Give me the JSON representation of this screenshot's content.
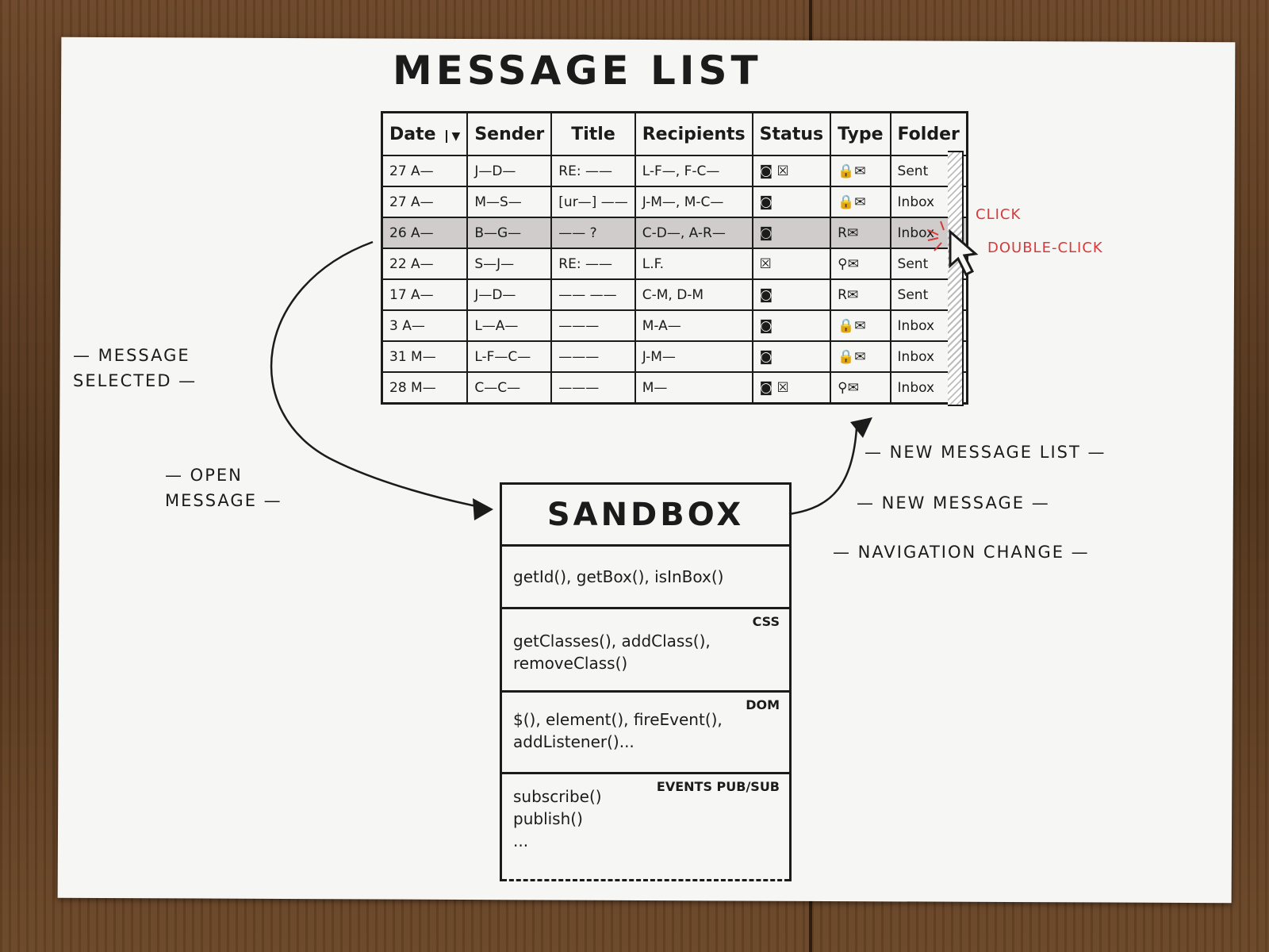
{
  "title": "MESSAGE LIST",
  "table": {
    "columns": [
      "Date",
      "Sender",
      "Title",
      "Recipients",
      "Status",
      "Type",
      "Folder"
    ],
    "rows": [
      {
        "date": "27 A—",
        "sender": "J—D—",
        "title": "RE: ——",
        "recipients": "L-F—, F-C—",
        "status": "◙ ☒",
        "type": "🔒✉",
        "folder": "Sent"
      },
      {
        "date": "27 A—",
        "sender": "M—S—",
        "title": "[ur—] ——",
        "recipients": "J-M—, M-C—",
        "status": "◙",
        "type": "🔒✉",
        "folder": "Inbox"
      },
      {
        "date": "26 A—",
        "sender": "B—G—",
        "title": "—— ?",
        "recipients": "C-D—, A-R—",
        "status": "◙",
        "type": "R✉",
        "folder": "Inbox"
      },
      {
        "date": "22 A—",
        "sender": "S—J—",
        "title": "RE: ——",
        "recipients": "L.F.",
        "status": "☒",
        "type": "⚲✉",
        "folder": "Sent"
      },
      {
        "date": "17 A—",
        "sender": "J—D—",
        "title": "—— ——",
        "recipients": "C-M, D-M",
        "status": "◙",
        "type": "R✉",
        "folder": "Sent"
      },
      {
        "date": "3 A—",
        "sender": "L—A—",
        "title": "———",
        "recipients": "M-A—",
        "status": "◙",
        "type": "🔒✉",
        "folder": "Inbox"
      },
      {
        "date": "31 M—",
        "sender": "L-F—C—",
        "title": "———",
        "recipients": "J-M—",
        "status": "◙",
        "type": "🔒✉",
        "folder": "Inbox"
      },
      {
        "date": "28 M—",
        "sender": "C—C—",
        "title": "———",
        "recipients": "M—",
        "status": "◙ ☒",
        "type": "⚲✉",
        "folder": "Inbox"
      }
    ]
  },
  "annotations": {
    "click": "CLICK",
    "double_click": "DOUBLE-CLICK",
    "message_selected": "— MESSAGE SELECTED —",
    "open_message": "— OPEN MESSAGE —",
    "new_message_list": "— NEW MESSAGE LIST —",
    "new_message": "— NEW MESSAGE —",
    "navigation_change": "— NAVIGATION CHANGE —"
  },
  "sandbox": {
    "title": "SANDBOX",
    "sections": [
      {
        "tag": "",
        "lines": [
          "getId(), getBox(), isInBox()"
        ]
      },
      {
        "tag": "CSS",
        "lines": [
          "getClasses(), addClass(),",
          "removeClass()"
        ]
      },
      {
        "tag": "DOM",
        "lines": [
          "$(), element(), fireEvent(),",
          "addListener()..."
        ]
      },
      {
        "tag": "EVENTS PUB/SUB",
        "lines": [
          "subscribe()",
          "publish()",
          "..."
        ]
      }
    ]
  },
  "colors": {
    "ink": "#1b1b1b",
    "paper": "#f6f6f4",
    "annotation_red": "#d63a3a",
    "selected_row": "#cfcccb"
  }
}
